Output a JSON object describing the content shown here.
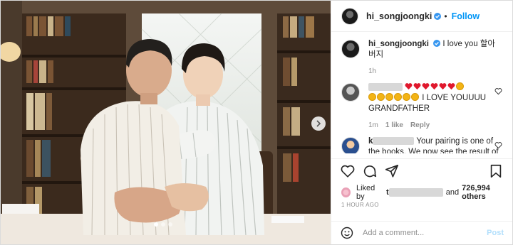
{
  "post": {
    "username": "hi_songjoongki",
    "follow_separator": "•",
    "follow_label": "Follow",
    "caption": {
      "username": "hi_songjoongki",
      "text": "I love you 할아버지",
      "age": "1h"
    },
    "comments": [
      {
        "username": "",
        "text": "I LOVE YOUUUU GRANDFATHER",
        "age": "1m",
        "likes": "1 like",
        "reply_label": "Reply"
      },
      {
        "username": "k",
        "text": "Your pairing is one of the books. We now see the result of"
      }
    ],
    "liked_by_prefix": "Liked by",
    "liked_by_name": "t",
    "liked_by_suffix": "and",
    "others_count": "726,994 others",
    "timestamp": "1 HOUR AGO",
    "composer": {
      "placeholder": "Add a comment...",
      "post_label": "Post"
    },
    "carousel": {
      "pages": 3,
      "current": 1
    },
    "icons": [
      "verified-badge-icon",
      "heart-icon",
      "comment-icon",
      "share-icon",
      "bookmark-icon",
      "emoji-icon",
      "chevron-right-icon"
    ],
    "colors": {
      "accent": "#0095f6",
      "post_disabled": "#b2dffc",
      "heart": "#ed4956"
    }
  }
}
